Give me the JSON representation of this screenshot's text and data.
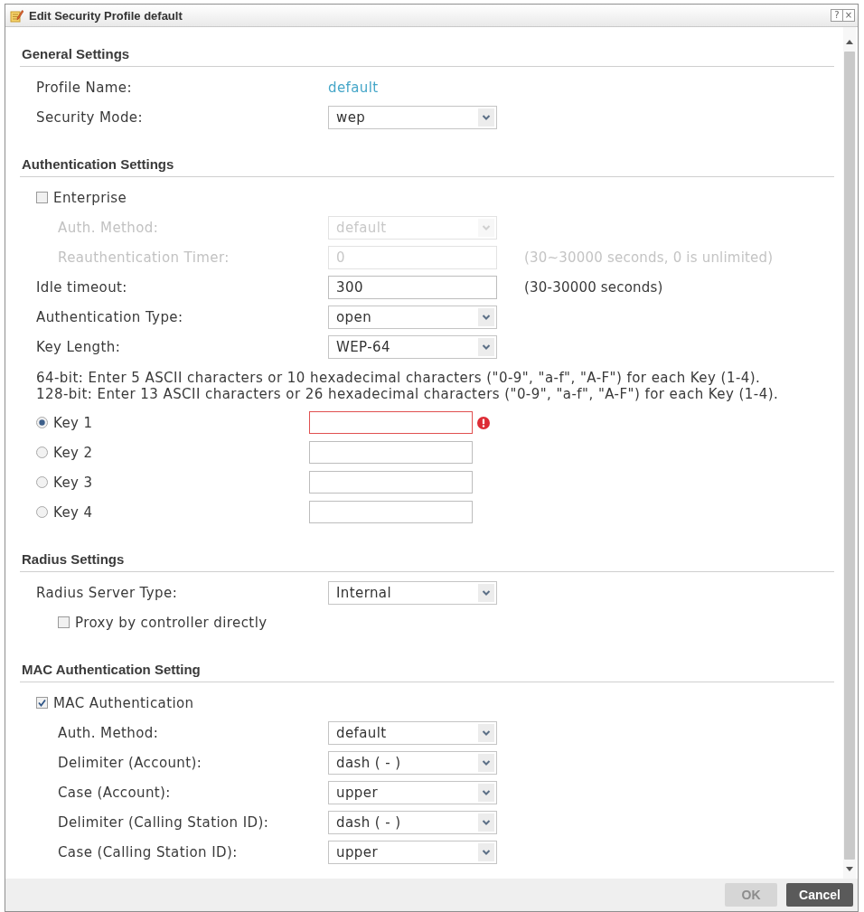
{
  "window": {
    "title": "Edit Security Profile default",
    "buttons": [
      "?",
      "×"
    ]
  },
  "sections": [
    {
      "title": "General Settings",
      "rows": [
        {
          "kind": "value",
          "label": "Profile Name:",
          "value": "default"
        },
        {
          "kind": "select",
          "label": "Security Mode:",
          "value": "wep",
          "disabled": false
        }
      ]
    },
    {
      "title": "Authentication Settings",
      "rows": [
        {
          "kind": "checkbox",
          "label": "Enterprise",
          "checked": false,
          "children": [
            {
              "kind": "select",
              "label": "Auth. Method:",
              "value": "default",
              "disabled": true
            },
            {
              "kind": "input",
              "label": "Reauthentication Timer:",
              "value": "0",
              "hint": "(30~30000 seconds, 0 is unlimited)",
              "disabled": true
            }
          ]
        },
        {
          "kind": "input",
          "label": "Idle timeout:",
          "value": "300",
          "hint": "(30-30000 seconds)",
          "disabled": false
        },
        {
          "kind": "select",
          "label": "Authentication Type:",
          "value": "open",
          "disabled": false
        },
        {
          "kind": "select",
          "label": "Key Length:",
          "value": "WEP-64",
          "disabled": false
        },
        {
          "kind": "note",
          "lines": [
            "64-bit: Enter 5 ASCII characters or 10 hexadecimal characters (\"0-9\", \"a-f\", \"A-F\") for each Key (1-4).",
            "128-bit: Enter 13 ASCII characters or 26 hexadecimal characters (\"0-9\", \"a-f\", \"A-F\") for each Key (1-4)."
          ]
        },
        {
          "kind": "radio",
          "label": "Key 1",
          "selected": true,
          "error": true
        },
        {
          "kind": "radio",
          "label": "Key 2",
          "selected": false,
          "error": false
        },
        {
          "kind": "radio",
          "label": "Key 3",
          "selected": false,
          "error": false
        },
        {
          "kind": "radio",
          "label": "Key 4",
          "selected": false,
          "error": false
        }
      ]
    },
    {
      "title": "Radius Settings",
      "rows": [
        {
          "kind": "select",
          "label": "Radius Server Type:",
          "value": "Internal",
          "disabled": false,
          "children": [
            {
              "kind": "checkbox",
              "label": "Proxy by controller directly",
              "checked": false
            }
          ]
        }
      ]
    },
    {
      "title": "MAC Authentication Setting",
      "rows": [
        {
          "kind": "checkbox",
          "label": "MAC Authentication",
          "checked": true,
          "children": [
            {
              "kind": "select",
              "label": "Auth. Method:",
              "value": "default",
              "disabled": false
            },
            {
              "kind": "select",
              "label": "Delimiter (Account):",
              "value": "dash ( - )",
              "disabled": false
            },
            {
              "kind": "select",
              "label": "Case (Account):",
              "value": "upper",
              "disabled": false
            },
            {
              "kind": "select",
              "label": "Delimiter (Calling Station ID):",
              "value": "dash ( - )",
              "disabled": false
            },
            {
              "kind": "select",
              "label": "Case (Calling Station ID):",
              "value": "upper",
              "disabled": false
            }
          ]
        }
      ]
    }
  ],
  "footer": {
    "buttons": [
      {
        "label": "OK",
        "disabled": true
      },
      {
        "label": "Cancel",
        "disabled": false
      }
    ]
  }
}
